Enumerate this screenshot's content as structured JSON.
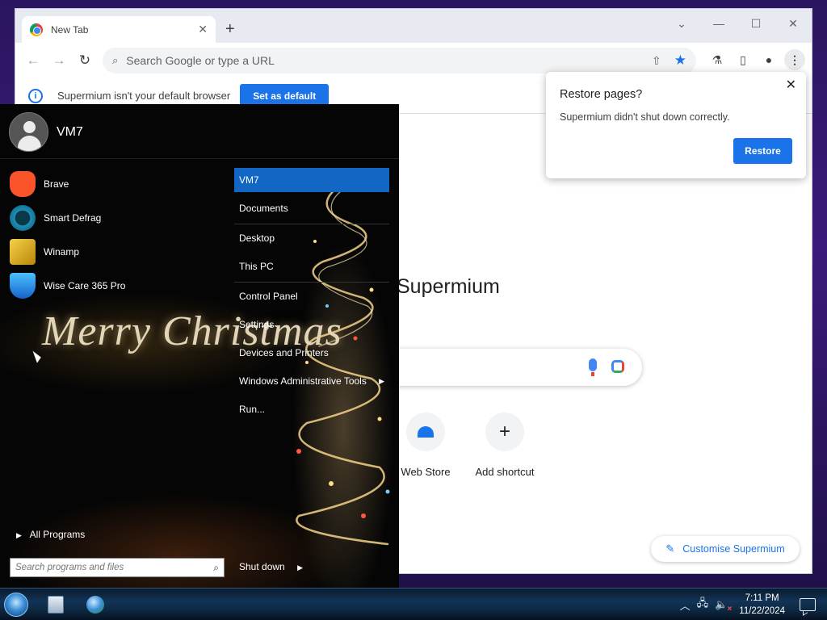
{
  "browser": {
    "tab": {
      "title": "New Tab",
      "close_glyph": "✕",
      "favicon_icon": "chrome-icon"
    },
    "new_tab_glyph": "+",
    "window_controls": {
      "dropdown": "⌄",
      "minimize": "—",
      "maximize": "☐",
      "close": "✕"
    },
    "toolbar": {
      "back": "←",
      "forward": "→",
      "reload": "↻",
      "search_icon": "⌕",
      "omnibox_placeholder": "Search Google or type a URL",
      "share_icon": "⇧",
      "star_icon": "★",
      "labs_icon": "⚗",
      "sidepanel_icon": "▯",
      "profile_icon": "●",
      "menu_icon": "⋮"
    },
    "infobar": {
      "info_glyph": "i",
      "message": "Supermium isn't your default browser",
      "button": "Set as default"
    },
    "ntp": {
      "logo_text": "Supermium",
      "shortcuts": [
        {
          "label": "Web Store",
          "icon": "webstore-icon"
        },
        {
          "label": "Add shortcut",
          "glyph": "+"
        }
      ],
      "customise": {
        "label": "Customise Supermium",
        "icon_glyph": "✎"
      }
    },
    "restore_popup": {
      "title": "Restore pages?",
      "message": "Supermium didn't shut down correctly.",
      "button": "Restore",
      "close_glyph": "✕"
    }
  },
  "start_menu": {
    "username": "VM7",
    "programs": [
      {
        "label": "Brave",
        "icon": "brave-icon"
      },
      {
        "label": "Smart Defrag",
        "icon": "smart-defrag-icon"
      },
      {
        "label": "Winamp",
        "icon": "winamp-icon"
      },
      {
        "label": "Wise Care 365 Pro",
        "icon": "wise-care-icon"
      }
    ],
    "wallpaper_text": "Merry Christmas",
    "right_items": [
      {
        "label": "VM7",
        "selected": true
      },
      {
        "label": "Documents"
      },
      {
        "label": "Desktop"
      },
      {
        "label": "This PC"
      },
      {
        "label": "Control Panel"
      },
      {
        "label": "Settings"
      },
      {
        "label": "Devices and Printers"
      },
      {
        "label": "Windows Administrative Tools",
        "submenu": true
      },
      {
        "label": "Run..."
      }
    ],
    "all_programs": "All Programs",
    "search_placeholder": "Search programs and files",
    "search_glyph": "⌕",
    "shutdown": "Shut down",
    "arrow_glyph": "▶"
  },
  "taskbar": {
    "apps": [
      {
        "icon": "file-explorer-icon"
      },
      {
        "icon": "browser-globe-icon"
      }
    ],
    "tray": {
      "chevron": "︿",
      "network_glyph": "🖧",
      "volume_glyph": "🔈"
    },
    "clock": {
      "time": "7:11 PM",
      "date": "11/22/2024"
    }
  }
}
